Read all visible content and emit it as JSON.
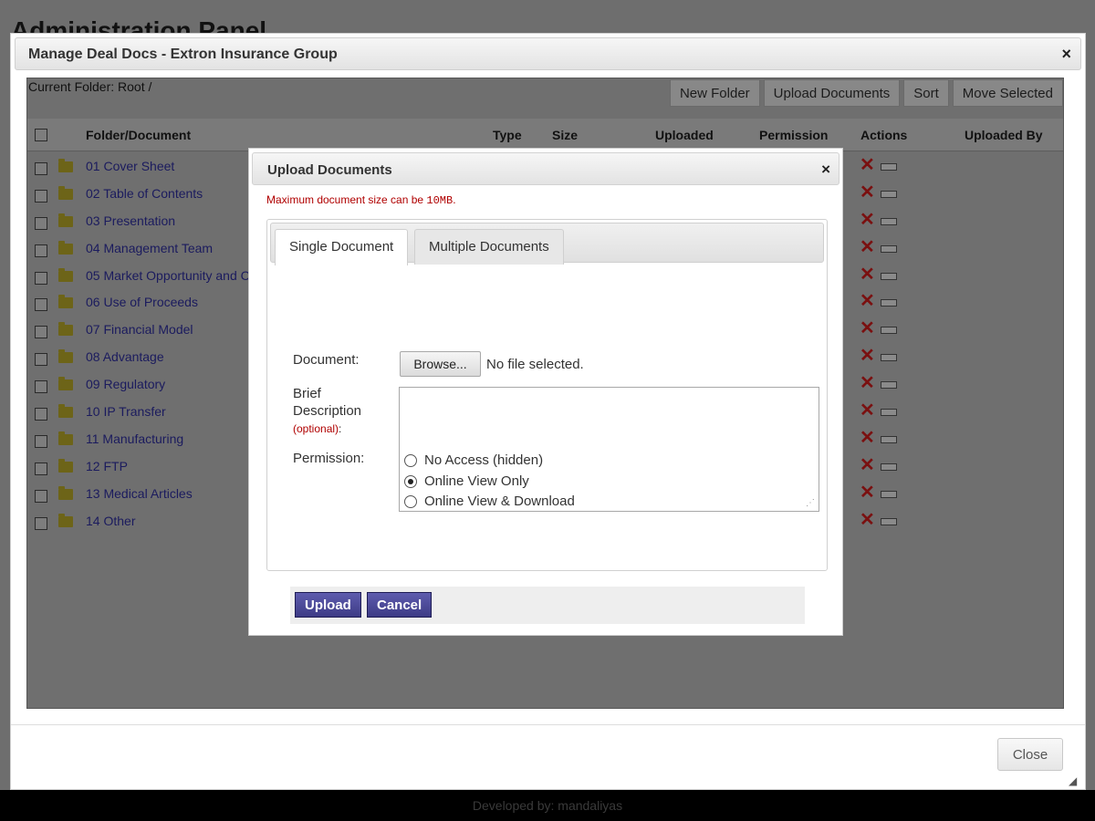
{
  "background": {
    "page_title": "Administration Panel",
    "footer": "Developed by: mandaliyas"
  },
  "dialog": {
    "title": "Manage Deal Docs - Extron Insurance Group",
    "close_symbol": "×",
    "close_label": "Close",
    "resize_symbol": "◢"
  },
  "folder_view": {
    "current_folder": "Current Folder: Root /",
    "toolbar": {
      "new_folder": "New Folder",
      "upload_documents": "Upload Documents",
      "sort": "Sort",
      "move_selected": "Move Selected"
    },
    "columns": {
      "name": "Folder/Document",
      "type": "Type",
      "size": "Size",
      "uploaded": "Uploaded",
      "permission": "Permission",
      "actions": "Actions",
      "uploaded_by": "Uploaded By"
    },
    "rows": [
      {
        "name": "01 Cover Sheet"
      },
      {
        "name": "02 Table of Contents"
      },
      {
        "name": "03 Presentation"
      },
      {
        "name": "04 Management Team"
      },
      {
        "name": "05 Market Opportunity and C"
      },
      {
        "name": "06 Use of Proceeds"
      },
      {
        "name": "07 Financial Model"
      },
      {
        "name": "08 Advantage"
      },
      {
        "name": "09 Regulatory"
      },
      {
        "name": "10 IP Transfer"
      },
      {
        "name": "11 Manufacturing"
      },
      {
        "name": "12 FTP"
      },
      {
        "name": "13 Medical Articles"
      },
      {
        "name": "14 Other"
      }
    ],
    "delete_symbol": "✕"
  },
  "upload_dialog": {
    "title": "Upload Documents",
    "close_symbol": "×",
    "max_note_prefix": "Maximum document size can be ",
    "max_size": "10MB",
    "max_note_suffix": ".",
    "tabs": {
      "single": "Single Document",
      "multiple": "Multiple Documents"
    },
    "document_label": "Document:",
    "browse_label": "Browse...",
    "no_file": "No file selected.",
    "description_label_1": "Brief",
    "description_label_2": "Description",
    "description_optional": "(optional)",
    "description_colon": ":",
    "description_value": "",
    "permission_label": "Permission:",
    "permission_options": [
      {
        "label": "No Access (hidden)",
        "selected": false
      },
      {
        "label": "Online View Only",
        "selected": true
      },
      {
        "label": "Online View & Download",
        "selected": false
      }
    ],
    "upload_label": "Upload",
    "cancel_label": "Cancel",
    "accent_color": "#3d3b86",
    "error_color": "#b00000"
  }
}
